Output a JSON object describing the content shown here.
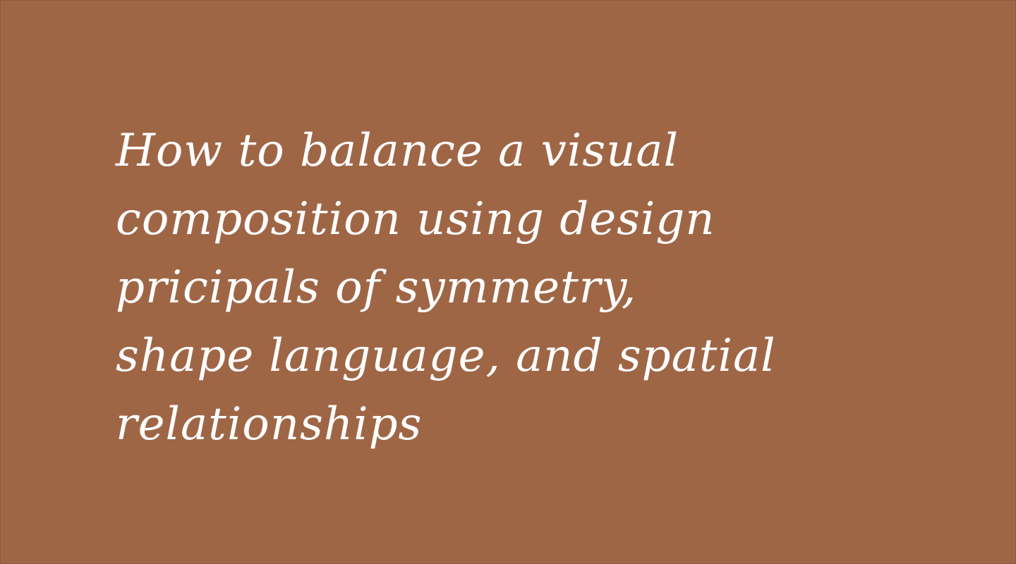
{
  "background_color": "#9f6646",
  "text_color": "#ffffff",
  "headline": {
    "lines": [
      "How to balance a visual",
      "composition using design",
      "pricipals of symmetry,",
      "shape language, and spatial",
      "relationships"
    ]
  }
}
